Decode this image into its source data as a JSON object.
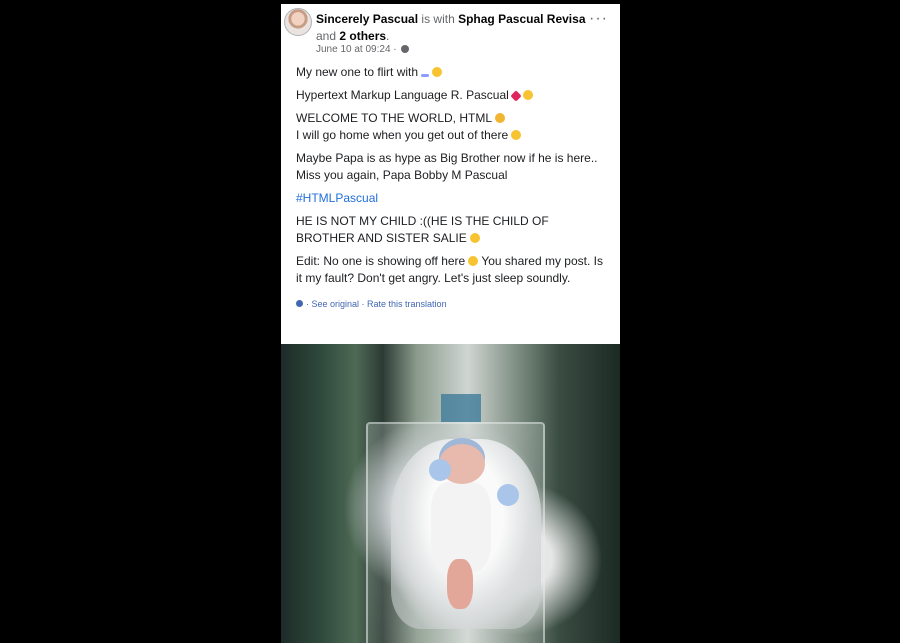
{
  "post": {
    "author": "Sincerely Pascual",
    "with_text": " is with ",
    "tagged": "Sphag Pascual Revisa",
    "and_text": " and ",
    "others": "2 others",
    "period": ".",
    "timestamp": "June 10 at 09:24 ·",
    "more_label": "···",
    "lines": [
      "My new one to flirt with",
      "Hypertext Markup Language R. Pascual",
      "WELCOME TO THE WORLD, HTML",
      "I will go home when you get out of there",
      "Maybe Papa is as hype as Big Brother now if he is here.. Miss you again, Papa Bobby M Pascual",
      "#HTMLPascual",
      "HE IS NOT MY CHILD :((HE IS THE CHILD OF BROTHER AND SISTER SALIE",
      "Edit: No one is showing off here",
      "You shared my post. Is it my fault? Don't get angry. Let's just sleep soundly."
    ],
    "translation": {
      "see_original": "See original",
      "separator": " · ",
      "rate": "Rate this translation",
      "prefix": "· "
    }
  },
  "icons": {
    "avatar": "profile-photo",
    "globe": "globe-icon",
    "more": "more-horizontal-icon",
    "translate": "gear-icon"
  },
  "colors": {
    "link": "#216fdb",
    "meta": "#65676b",
    "text": "#1c1e21"
  }
}
